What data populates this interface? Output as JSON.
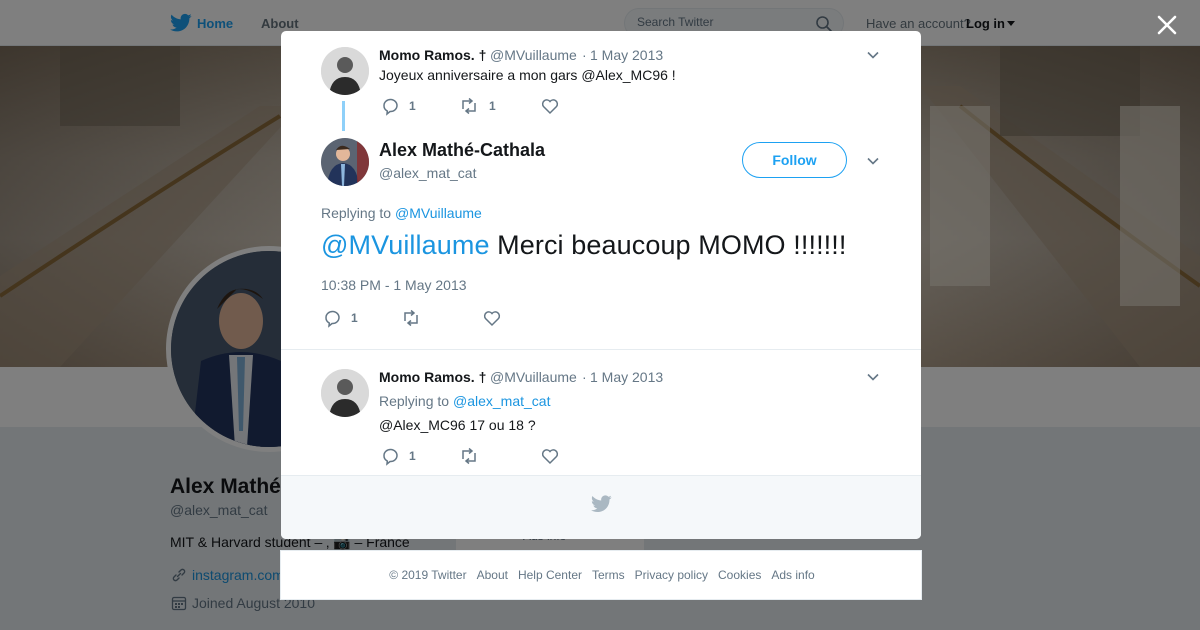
{
  "topbar": {
    "home_label": "Home",
    "about_label": "About",
    "search_placeholder": "Search Twitter",
    "account_prompt": "Have an account?",
    "login_label": "Log in"
  },
  "profile": {
    "name": "Alex Mathé",
    "handle": "@alex_mat_cat",
    "bio": "MIT & Harvard student – ‚ 📷 – France",
    "link": "instagram.com",
    "joined": "Joined August 2010",
    "ads_info_behind": "Ads info"
  },
  "modal": {
    "parent_tweet": {
      "name": "Momo Ramos. †",
      "handle": "@MVuillaume",
      "sep": "·",
      "date": "1 May 2013",
      "text": "Joyeux anniversaire a mon gars @Alex_MC96 !",
      "replies": "1",
      "retweets": "1"
    },
    "main_tweet": {
      "name": "Alex Mathé-Cathala",
      "handle": "@alex_mat_cat",
      "follow_label": "Follow",
      "replying_to_label": "Replying to",
      "replying_to_handle": "@MVuillaume",
      "text_mention": "@MVuillaume",
      "text_body": " Merci beaucoup MOMO !!!!!!!",
      "timestamp": "10:38 PM - 1 May 2013",
      "replies": "1"
    },
    "reply_tweet": {
      "name": "Momo Ramos. †",
      "handle": "@MVuillaume",
      "sep": "·",
      "date": "1 May 2013",
      "replying_to_label": "Replying to",
      "replying_to_handle": "@alex_mat_cat",
      "text": "@Alex_MC96 17 ou 18 ?",
      "replies": "1"
    }
  },
  "footer": {
    "copyright": "© 2019 Twitter",
    "links": [
      "About",
      "Help Center",
      "Terms",
      "Privacy policy",
      "Cookies",
      "Ads info"
    ]
  },
  "colors": {
    "brand": "#1da1f2",
    "link": "#1b95e0",
    "text": "#14171a",
    "secondary": "#657786",
    "thread_line": "#8ed0f9"
  },
  "icons": [
    "twitter-bird-icon",
    "search-icon",
    "caret-down-icon",
    "close-icon",
    "reply-icon",
    "retweet-icon",
    "like-icon",
    "link-icon",
    "calendar-icon"
  ]
}
